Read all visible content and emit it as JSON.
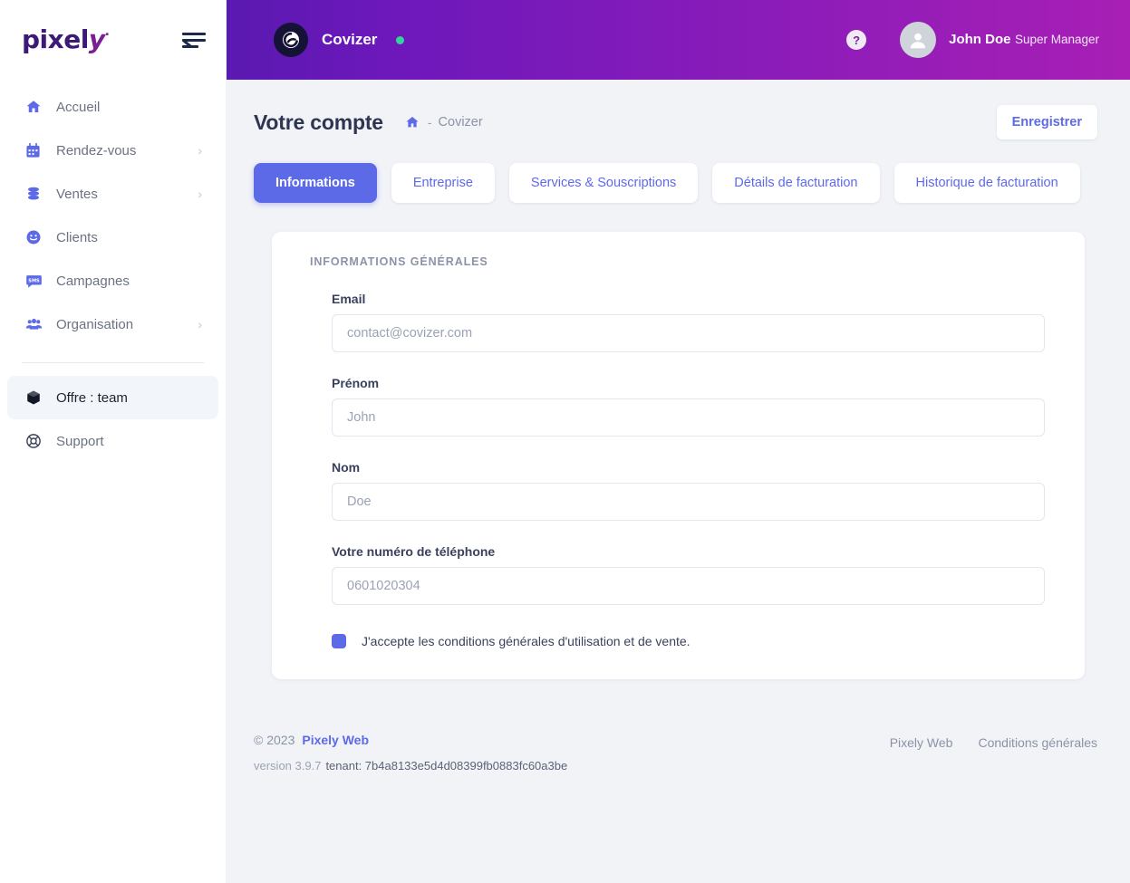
{
  "brand": {
    "logo_text_1": "pixel",
    "logo_text_2": "y",
    "logo_dot": "·"
  },
  "sidebar": {
    "items": [
      {
        "label": "Accueil",
        "icon": "home-icon",
        "chevron": "",
        "active": false
      },
      {
        "label": "Rendez-vous",
        "icon": "calendar-icon",
        "chevron": "›",
        "active": false
      },
      {
        "label": "Ventes",
        "icon": "coins-icon",
        "chevron": "›",
        "active": false
      },
      {
        "label": "Clients",
        "icon": "smiley-icon",
        "chevron": "",
        "active": false
      },
      {
        "label": "Campagnes",
        "icon": "sms-bubble-icon",
        "chevron": "",
        "active": false
      },
      {
        "label": "Organisation",
        "icon": "users-icon",
        "chevron": "›",
        "active": false
      }
    ],
    "offer": {
      "label": "Offre : team",
      "icon": "cube-icon"
    },
    "support": {
      "label": "Support",
      "icon": "lifebuoy-icon"
    }
  },
  "topbar": {
    "tenant_name": "Covizer",
    "status": "online",
    "help_label": "?",
    "user_name": "John Doe",
    "user_role": "Super Manager"
  },
  "page": {
    "title": "Votre compte",
    "breadcrumb_separator": "-",
    "breadcrumb_current": "Covizer",
    "save_label": "Enregistrer"
  },
  "tabs": [
    {
      "label": "Informations",
      "active": true
    },
    {
      "label": "Entreprise",
      "active": false
    },
    {
      "label": "Services & Souscriptions",
      "active": false
    },
    {
      "label": "Détails de facturation",
      "active": false
    },
    {
      "label": "Historique de facturation",
      "active": false
    }
  ],
  "form": {
    "section_title": "INFORMATIONS GÉNÉRALES",
    "fields": [
      {
        "label": "Email",
        "value": "",
        "placeholder": "contact@covizer.com",
        "name": "email-field"
      },
      {
        "label": "Prénom",
        "value": "",
        "placeholder": "John",
        "name": "first-name-field"
      },
      {
        "label": "Nom",
        "value": "",
        "placeholder": "Doe",
        "name": "last-name-field"
      },
      {
        "label": "Votre numéro de téléphone",
        "value": "",
        "placeholder": "0601020304",
        "name": "phone-field"
      }
    ],
    "terms_label": "J'accepte les conditions générales d'utilisation et de vente.",
    "terms_checked": true
  },
  "footer": {
    "copyright": "© 2023",
    "company": "Pixely Web",
    "version": "version 3.9.7",
    "tenant": "tenant: 7b4a8133e5d4d08399fb0883fc60a3be",
    "links": [
      "Pixely Web",
      "Conditions générales"
    ]
  },
  "colors": {
    "accent": "#5d6ae8",
    "header_gradient_start": "#5a19b0",
    "header_gradient_end": "#a81fb5",
    "status_green": "#34d399",
    "page_bg": "#f1f3f7"
  }
}
